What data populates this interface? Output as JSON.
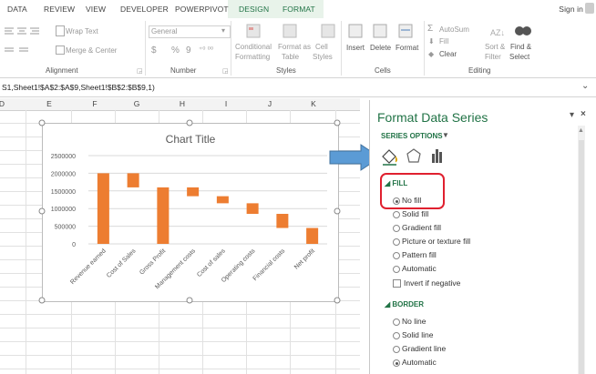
{
  "ribbon_tabs": [
    "DATA",
    "REVIEW",
    "VIEW",
    "DEVELOPER",
    "POWERPIVOT",
    "DESIGN",
    "FORMAT"
  ],
  "sign_in": "Sign in",
  "ribbon": {
    "wrap_text": "Wrap Text",
    "merge_center": "Merge & Center",
    "number_format": "General",
    "currency": "$",
    "percent": "%",
    "comma": "9",
    "conditional_formatting": [
      "Conditional",
      "Formatting"
    ],
    "format_as_table": [
      "Format as",
      "Table"
    ],
    "cell_styles": [
      "Cell",
      "Styles"
    ],
    "insert": "Insert",
    "delete": "Delete",
    "format": "Format",
    "autosum": "AutoSum",
    "fill": "Fill",
    "clear": "Clear",
    "sort_filter": [
      "Sort &",
      "Filter"
    ],
    "find_select": [
      "Find &",
      "Select"
    ],
    "groups": [
      "Alignment",
      "Number",
      "Styles",
      "Cells",
      "Editing"
    ]
  },
  "formula_bar": {
    "text": "S1,Sheet1!$A$2:$A$9,Sheet1!$B$2:$B$9,1)"
  },
  "columns": [
    "D",
    "E",
    "F",
    "G",
    "H",
    "I",
    "J",
    "K"
  ],
  "chart_data": {
    "type": "bar",
    "title": "Chart Title",
    "categories": [
      "Revenue earned",
      "Cost of Sales",
      "Gross Profit",
      "Management costs",
      "Cost of sales",
      "Operating costs",
      "Financial costs",
      "Net profit"
    ],
    "series": [
      {
        "values": [
          [
            0,
            2000000
          ],
          [
            1600000,
            2000000
          ],
          [
            0,
            1600000
          ],
          [
            1350000,
            1600000
          ],
          [
            1150000,
            1350000
          ],
          [
            850000,
            1150000
          ],
          [
            450000,
            850000
          ],
          [
            0,
            450000
          ]
        ]
      }
    ],
    "y_ticks": [
      "2500000",
      "2000000",
      "1500000",
      "1000000",
      "500000",
      "0"
    ],
    "ylim": [
      0,
      2500000
    ],
    "grid": true,
    "bar_color": "#ed7d31"
  },
  "pane": {
    "title": "Format Data Series",
    "series_options": "SERIES OPTIONS",
    "fill_section": "FILL",
    "fill_options": [
      "No fill",
      "Solid fill",
      "Gradient fill",
      "Picture or texture fill",
      "Pattern fill",
      "Automatic"
    ],
    "invert_if_negative": "Invert if negative",
    "border_section": "BORDER",
    "border_options": [
      "No line",
      "Solid line",
      "Gradient line",
      "Automatic"
    ]
  },
  "colors": {
    "accent_green": "#217346",
    "arrow_blue": "#5b9bd5",
    "highlight_red": "#e0202f"
  }
}
